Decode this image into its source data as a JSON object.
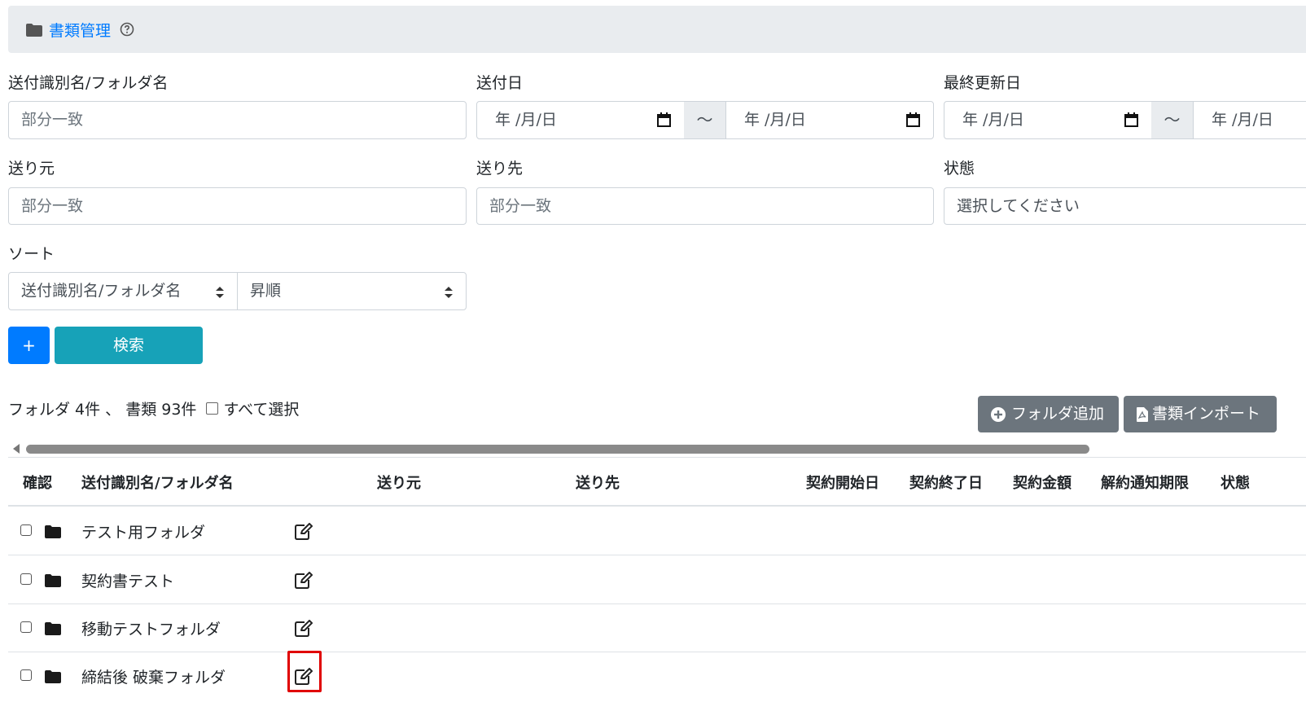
{
  "header": {
    "title": "書類管理",
    "folder_icon": "folder-icon",
    "help_icon": "question-circle-icon"
  },
  "filters": {
    "sender_id_label": "送付識別名/フォルダ名",
    "sender_id_placeholder": "部分一致",
    "send_date_label": "送付日",
    "last_updated_label": "最終更新日",
    "date_placeholder": "年 /月/日",
    "range_sep": "～",
    "from_label": "送り元",
    "from_placeholder": "部分一致",
    "to_label": "送り先",
    "to_placeholder": "部分一致",
    "status_label": "状態",
    "status_placeholder": "選択してください",
    "sort_label": "ソート",
    "sort_field": "送付識別名/フォルダ名",
    "sort_order": "昇順"
  },
  "actions": {
    "plus_label": "+",
    "search_label": "検索",
    "add_folder_label": "フォルダ追加",
    "import_label": "書類インポート"
  },
  "summary": {
    "counts": "フォルダ 4件 、 書類 93件",
    "select_all": "すべて選択"
  },
  "table": {
    "headers": [
      "確認",
      "送付識別名/フォルダ名",
      "送り元",
      "送り先",
      "契約開始日",
      "契約終了日",
      "契約金額",
      "解約通知期限",
      "状態"
    ],
    "rows": [
      {
        "name": "テスト用フォルダ"
      },
      {
        "name": "契約書テスト"
      },
      {
        "name": "移動テストフォルダ"
      },
      {
        "name": "締結後 破棄フォルダ"
      }
    ]
  },
  "colors": {
    "primary": "#007bff",
    "info": "#17a2b8",
    "secondary": "#6c757d",
    "highlight": "#e00000"
  }
}
